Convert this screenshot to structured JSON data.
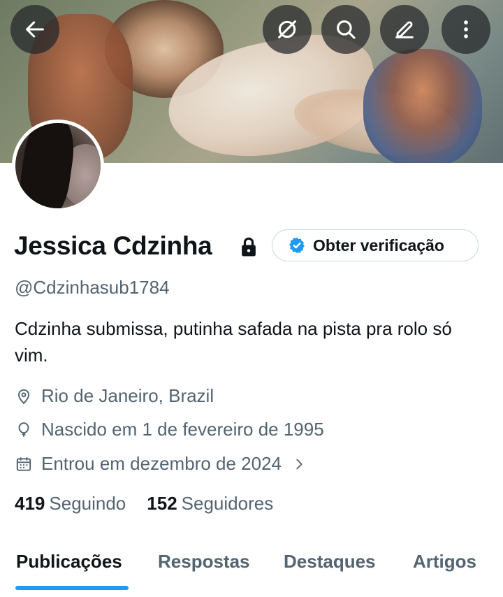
{
  "header": {
    "buttons": [
      {
        "name": "back-button",
        "icon": "arrow-left-icon"
      },
      {
        "name": "grok-button",
        "icon": "grok-icon"
      },
      {
        "name": "search-button",
        "icon": "search-icon"
      },
      {
        "name": "edit-button",
        "icon": "pencil-icon"
      },
      {
        "name": "more-button",
        "icon": "more-vertical-icon"
      }
    ]
  },
  "profile": {
    "name": "Jessica Cdzinha",
    "verify_label": "Obter verificação",
    "handle": "@Cdzinhasub1784",
    "bio": "Cdzinha submissa, putinha safada na pista pra rolo só vim.",
    "location": "Rio de Janeiro, Brazil",
    "birthdate": "Nascido em 1 de fevereiro de 1995",
    "joined": "Entrou em dezembro de 2024",
    "following_count": "419",
    "following_label": "Seguindo",
    "followers_count": "152",
    "followers_label": "Seguidores"
  },
  "tabs": [
    {
      "label": "Publicações",
      "active": true
    },
    {
      "label": "Respostas",
      "active": false
    },
    {
      "label": "Destaques",
      "active": false
    },
    {
      "label": "Artigos",
      "active": false
    }
  ],
  "colors": {
    "accent": "#1d9bf0",
    "text": "#0f1419",
    "secondary": "#536471"
  }
}
